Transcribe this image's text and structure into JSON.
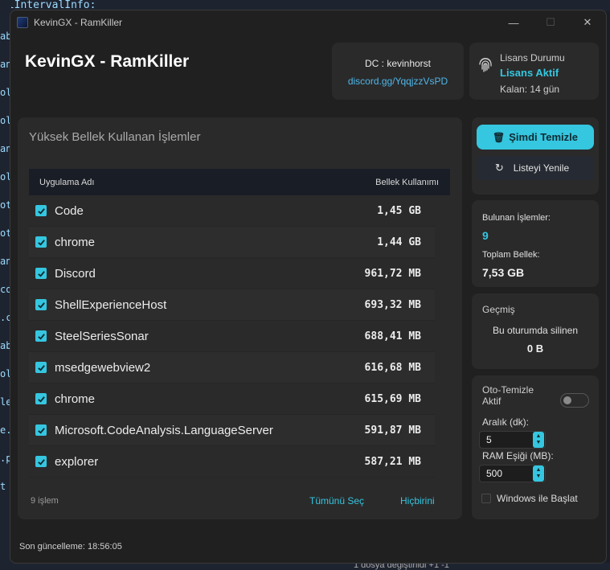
{
  "background": {
    "top_code": "olIntervalInfo:",
    "left_fragments": [
      "ab",
      "an",
      "ol",
      "ol",
      "an",
      "ol",
      "ot",
      "ot",
      "an",
      "co",
      ".c",
      "ab",
      "ol",
      "le",
      "e.p",
      ".p",
      "t"
    ],
    "bottom_text": "1 dosya değiştirildi +1 -1"
  },
  "window": {
    "title": "KevinGX - RamKiller",
    "controls": {
      "minimize": "—",
      "maximize": "☐",
      "close": "✕"
    }
  },
  "header": {
    "title": "KevinGX - RamKiller",
    "dc_label": "DC : kevinhorst",
    "dc_link": "discord.gg/YqqjzzVsPD"
  },
  "license": {
    "label": "Lisans Durumu",
    "status": "Lisans Aktif",
    "remaining": "Kalan: 14 gün",
    "icon": "fingerprint-icon"
  },
  "processes": {
    "title": "Yüksek Bellek Kullanan İşlemler",
    "col_name": "Uygulama Adı",
    "col_mem": "Bellek Kullanımı",
    "rows": [
      {
        "name": "Code",
        "mem": "1,45 GB"
      },
      {
        "name": "chrome",
        "mem": "1,44 GB"
      },
      {
        "name": "Discord",
        "mem": "961,72 MB"
      },
      {
        "name": "ShellExperienceHost",
        "mem": "693,32 MB"
      },
      {
        "name": "SteelSeriesSonar",
        "mem": "688,41 MB"
      },
      {
        "name": "msedgewebview2",
        "mem": "616,68 MB"
      },
      {
        "name": "chrome",
        "mem": "615,69 MB"
      },
      {
        "name": "Microsoft.CodeAnalysis.LanguageServer",
        "mem": "591,87 MB"
      },
      {
        "name": "explorer",
        "mem": "587,21 MB"
      }
    ],
    "count": "9 işlem",
    "select_all": "Tümünü Seç",
    "select_none": "Hiçbirini"
  },
  "actions": {
    "clean": "Şimdi Temizle",
    "refresh": "Listeyi Yenile"
  },
  "stats": {
    "found_label": "Bulunan İşlemler:",
    "found_value": "9",
    "total_label": "Toplam Bellek:",
    "total_value": "7,53 GB"
  },
  "history": {
    "title": "Geçmiş",
    "subtitle": "Bu oturumda silinen",
    "value": "0 B"
  },
  "auto": {
    "label": "Oto-Temizle Aktif",
    "enabled": false,
    "interval_label": "Aralık (dk):",
    "interval_value": "5",
    "threshold_label": "RAM Eşiği (MB):",
    "threshold_value": "500",
    "windows_start": "Windows ile Başlat"
  },
  "status": {
    "last_update": "Son güncelleme: 18:56:05"
  },
  "colors": {
    "accent": "#35c6e0",
    "link": "#4fb6e8",
    "panel": "#2a2a2a",
    "window": "#202020"
  }
}
